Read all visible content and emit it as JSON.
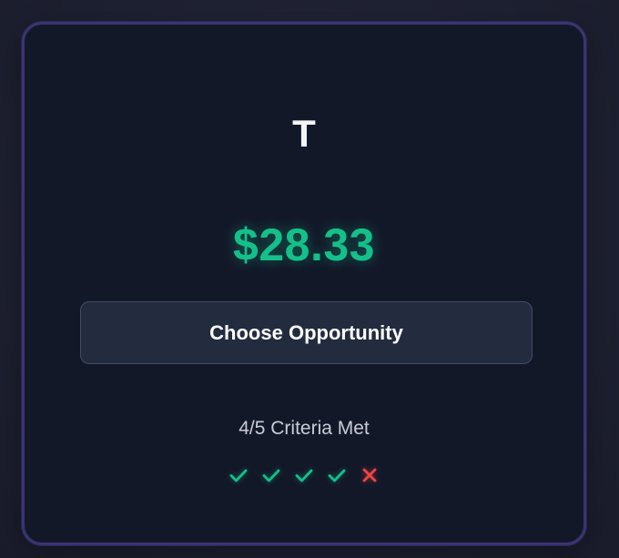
{
  "card": {
    "ticker": "T",
    "price": "$28.33",
    "button_label": "Choose Opportunity",
    "criteria_label": "4/5 Criteria Met",
    "criteria": [
      {
        "icon": "check-icon",
        "met": true
      },
      {
        "icon": "check-icon",
        "met": true
      },
      {
        "icon": "check-icon",
        "met": true
      },
      {
        "icon": "check-icon",
        "met": true
      },
      {
        "icon": "x-icon",
        "met": false
      }
    ]
  },
  "colors": {
    "accent_green": "#14c08a",
    "fail_red": "#ef4444",
    "card_border": "#3b3472",
    "card_bg": "#131829"
  }
}
